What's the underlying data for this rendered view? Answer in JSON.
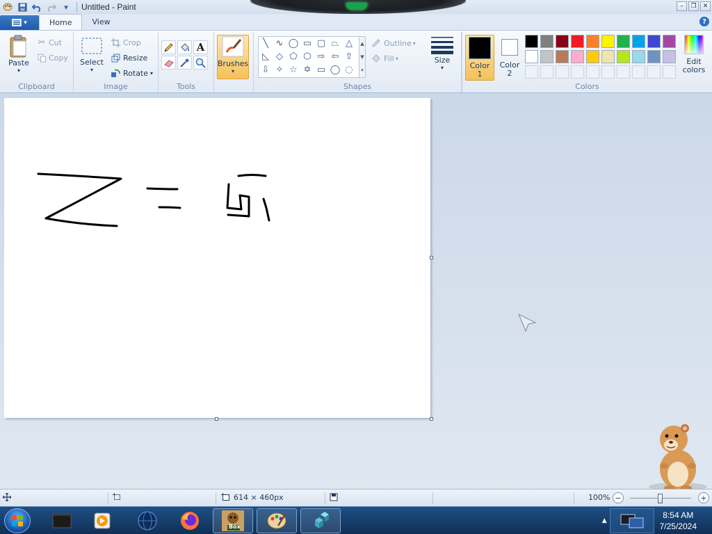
{
  "title_bar": {
    "title": "Untitled - Paint",
    "qat_dropdown": "▾"
  },
  "window_controls": {
    "minimize": "–",
    "restore": "❐",
    "close": "✕"
  },
  "tabs": {
    "home": "Home",
    "view": "View",
    "help": "?"
  },
  "clipboard": {
    "paste": "Paste",
    "cut": "Cut",
    "copy": "Copy",
    "label": "Clipboard"
  },
  "image": {
    "select": "Select",
    "crop": "Crop",
    "resize": "Resize",
    "rotate": "Rotate",
    "label": "Image"
  },
  "tools": {
    "label": "Tools",
    "text_tool": "A"
  },
  "brushes": {
    "label": "Brushes"
  },
  "shapes": {
    "outline": "Outline",
    "fill": "Fill",
    "label": "Shapes"
  },
  "size": {
    "label": "Size"
  },
  "colors": {
    "color1_line1": "Color",
    "color1_line2": "1",
    "color2_line1": "Color",
    "color2_line2": "2",
    "edit_line1": "Edit",
    "edit_line2": "colors",
    "label": "Colors",
    "color1": "#000000",
    "color2": "#ffffff",
    "palette_row1": [
      "#000000",
      "#7f7f7f",
      "#880015",
      "#ed1c24",
      "#ff7f27",
      "#fff200",
      "#22b14c",
      "#00a2e8",
      "#3f48cc",
      "#a349a4"
    ],
    "palette_row2": [
      "#ffffff",
      "#c3c3c3",
      "#b97a57",
      "#ffaec9",
      "#ffc90e",
      "#efe4b0",
      "#b5e61d",
      "#99d9ea",
      "#7092be",
      "#c8bfe7"
    ],
    "accent": "#f5c15a"
  },
  "status_bar": {
    "canvas_size": "614 × 460px",
    "zoom": "100%",
    "zoom_fraction": 0.5
  },
  "taskbar": {
    "time": "8:54 AM",
    "date": "7/25/2024",
    "box_label": "Box"
  }
}
